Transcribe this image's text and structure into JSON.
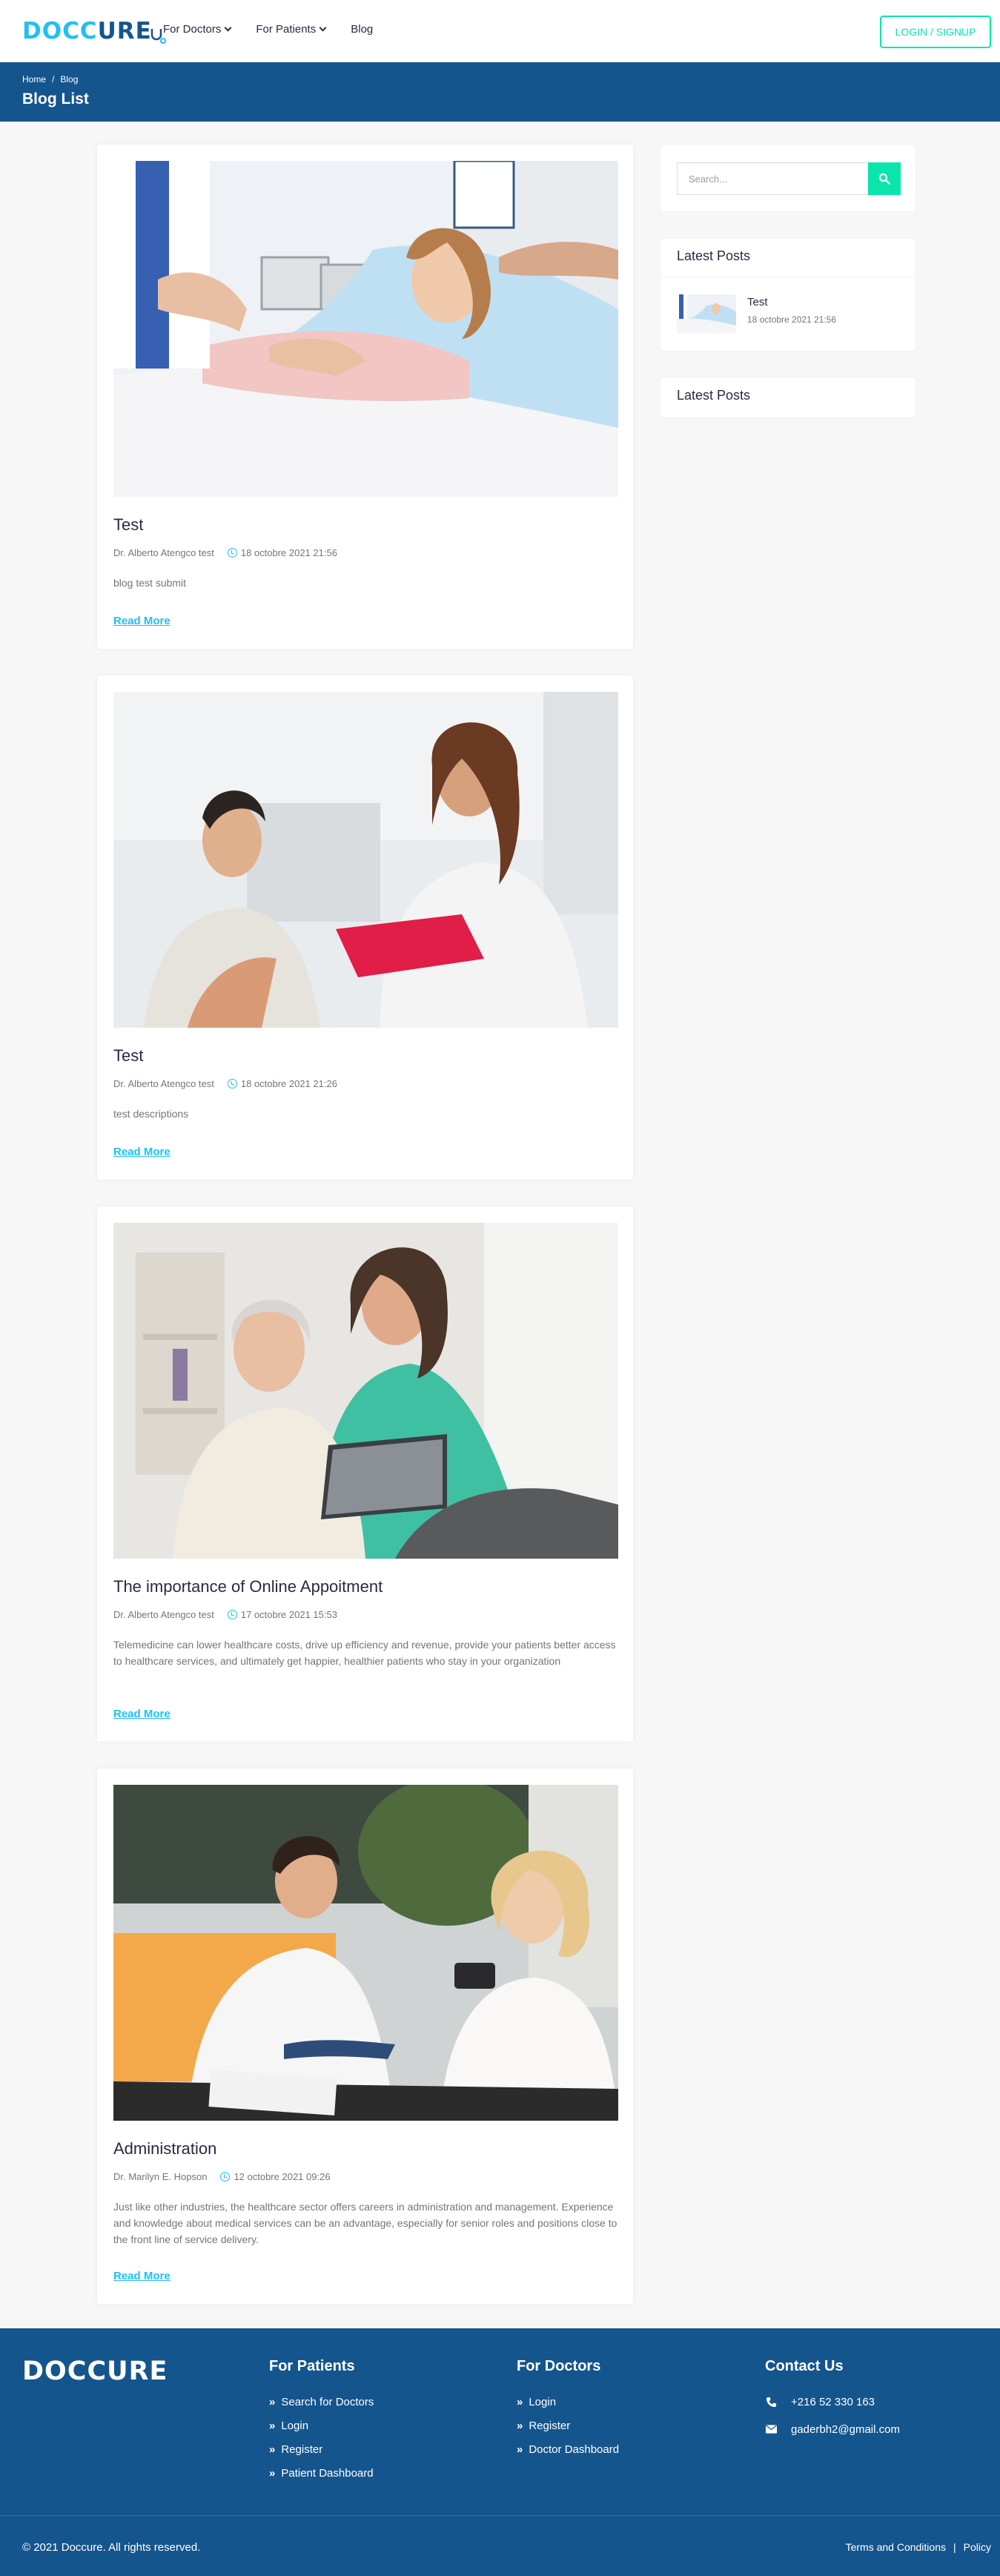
{
  "brand": {
    "logo_text": "DOCCURE",
    "accent": "#20c0f3",
    "primary": "#15558d",
    "cta": "#09e5ab"
  },
  "header": {
    "nav": [
      {
        "label": "For Doctors",
        "has_dropdown": true
      },
      {
        "label": "For Patients",
        "has_dropdown": true
      },
      {
        "label": "Blog",
        "has_dropdown": false
      }
    ],
    "login_label": "LOGIN / SIGNUP"
  },
  "breadcrumb": {
    "home": "Home",
    "separator": "/",
    "current": "Blog",
    "title": "Blog List"
  },
  "posts": [
    {
      "title": "Test",
      "author": "Dr. Alberto Atengco test",
      "date": "18 octobre 2021 21:56",
      "description": "blog test submit",
      "read_more": "Read More"
    },
    {
      "title": "Test",
      "author": "Dr. Alberto Atengco test",
      "date": "18 octobre 2021 21:26",
      "description": "test descriptions",
      "read_more": "Read More"
    },
    {
      "title": "The importance of Online Appoitment",
      "author": "Dr. Alberto Atengco test",
      "date": "17 octobre 2021 15:53",
      "description": "Telemedicine can lower healthcare costs, drive up efficiency and revenue, provide your patients better access to healthcare services, and ultimately get happier, healthier patients who stay in your organization",
      "read_more": "Read More"
    },
    {
      "title": "Administration",
      "author": "Dr. Marilyn E. Hopson",
      "date": "12 octobre 2021 09:26",
      "description": "Just like other industries, the healthcare sector offers careers in administration and management. Experience and knowledge about medical services can be an advantage, especially for senior roles and positions close to the front line of service delivery.",
      "read_more": "Read More"
    }
  ],
  "sidebar": {
    "search_placeholder": "Search...",
    "latest_posts_title": "Latest Posts",
    "latest_posts": [
      {
        "title": "Test",
        "date": "18 octobre 2021 21:56"
      }
    ],
    "latest_posts_title_2": "Latest Posts"
  },
  "footer": {
    "logo_text": "DOCCURE",
    "patients": {
      "title": "For Patients",
      "links": [
        "Search for Doctors",
        "Login",
        "Register",
        "Patient Dashboard"
      ]
    },
    "doctors": {
      "title": "For Doctors",
      "links": [
        "Login",
        "Register",
        "Doctor Dashboard"
      ]
    },
    "contact": {
      "title": "Contact Us",
      "phone": "+216 52 330 163",
      "email": "gaderbh2@gmail.com"
    },
    "copyright": "© 2021 Doccure. All rights reserved.",
    "terms": "Terms and Conditions",
    "policy": "Policy",
    "links_separator": "|"
  }
}
